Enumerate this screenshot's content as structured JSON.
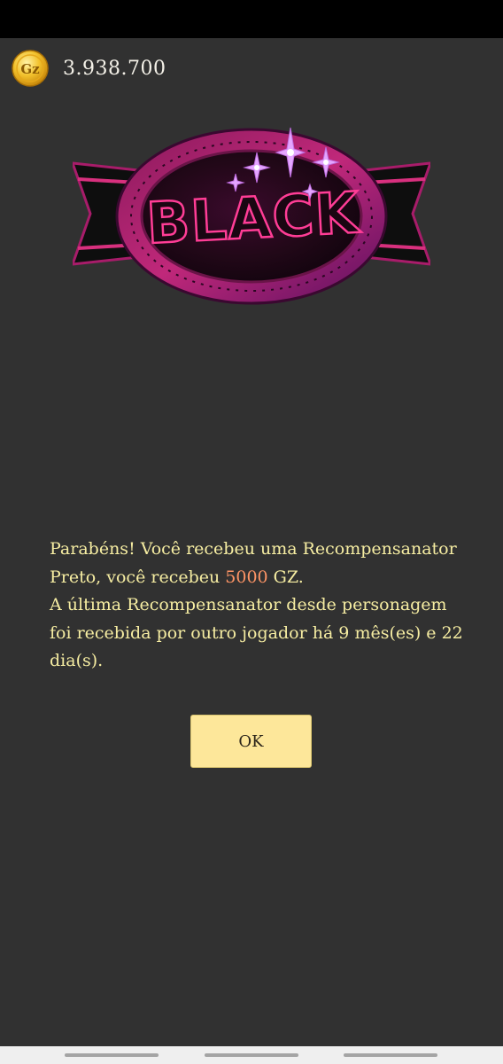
{
  "header": {
    "currency_icon": "gz-coin-icon",
    "currency_icon_label": "Gz",
    "currency_amount": "3.938.700"
  },
  "badge": {
    "label": "BLACK",
    "icon": "black-badge-icon"
  },
  "message": {
    "line_a": "Parabéns! Você recebeu uma Recompensanator Preto, você recebeu ",
    "reward_amount": "5000",
    "line_b": " GZ.",
    "line_c": "A última Recompensanator desde personagem foi recebida por outro jogador há 9 mês(es) e 22 dia(s)."
  },
  "ok_button_label": "OK",
  "colors": {
    "background": "#313131",
    "message_text": "#f6eda2",
    "reward_highlight": "#ff9566",
    "button_bg": "#fde79a",
    "badge_pink": "#e0237a",
    "badge_purple": "#b04fc4"
  }
}
